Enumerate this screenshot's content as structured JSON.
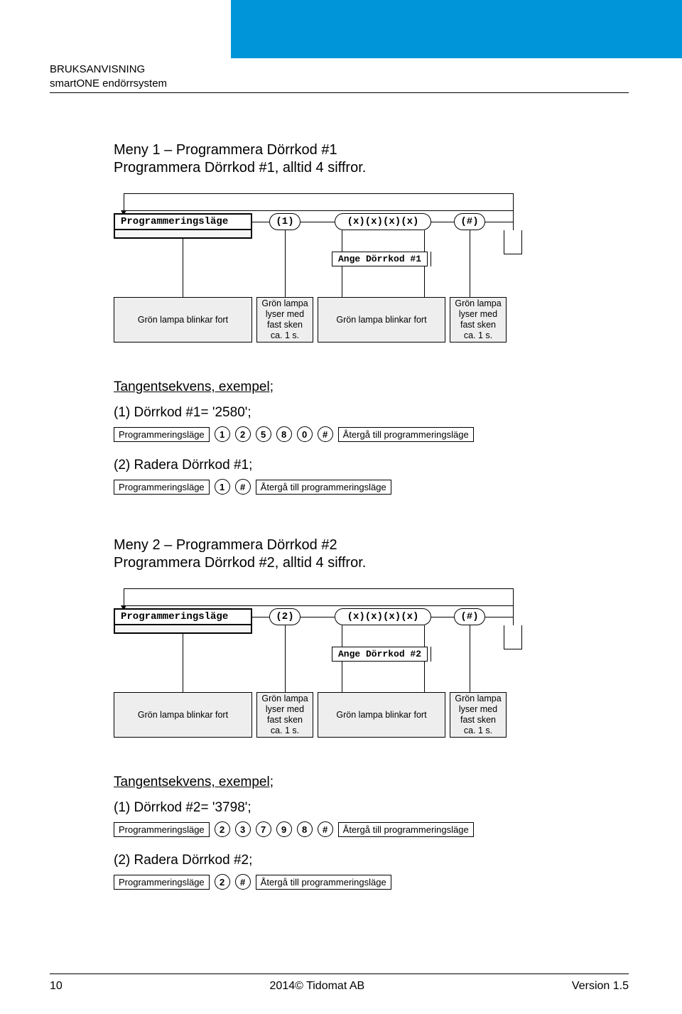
{
  "header": {
    "line1": "BRUKSANVISNING",
    "line2": "smartONE endörrsystem"
  },
  "menu1": {
    "title": "Meny 1 – Programmera Dörrkod #1",
    "subtitle": "Programmera Dörrkod #1, alltid 4 siffror.",
    "flow": {
      "prog": "Programmeringsläge",
      "key1": "(1)",
      "keyx": "(x)(x)(x)(x)",
      "keyh": "(#)",
      "ange": "Ange Dörrkod #1",
      "box1": "Grön lampa blinkar fort",
      "box2": "Grön lampa lyser med fast sken ca. 1 s.",
      "box3": "Grön lampa blinkar fort",
      "box4": "Grön lampa lyser med fast sken ca. 1 s."
    },
    "ex_head": "Tangentsekvens, exempel;",
    "ex1_label": "(1) Dörrkod #1= '2580';",
    "ex1_prog": "Programmeringsläge",
    "ex1_keys": [
      "1",
      "2",
      "5",
      "8",
      "0",
      "#"
    ],
    "ex1_aterga": "Återgå till programmeringsläge",
    "ex2_label": "(2) Radera Dörrkod #1;",
    "ex2_prog": "Programmeringsläge",
    "ex2_keys": [
      "1",
      "#"
    ],
    "ex2_aterga": "Återgå till programmeringsläge"
  },
  "menu2": {
    "title": "Meny 2 – Programmera Dörrkod #2",
    "subtitle": "Programmera Dörrkod #2, alltid 4 siffror.",
    "flow": {
      "prog": "Programmeringsläge",
      "key1": "(2)",
      "keyx": "(x)(x)(x)(x)",
      "keyh": "(#)",
      "ange": "Ange Dörrkod #2",
      "box1": "Grön lampa blinkar fort",
      "box2": "Grön lampa lyser med fast sken ca. 1 s.",
      "box3": "Grön lampa blinkar fort",
      "box4": "Grön lampa lyser med fast sken ca. 1 s."
    },
    "ex_head": "Tangentsekvens, exempel;",
    "ex1_label": "(1) Dörrkod #2= '3798';",
    "ex1_prog": "Programmeringsläge",
    "ex1_keys": [
      "2",
      "3",
      "7",
      "9",
      "8",
      "#"
    ],
    "ex1_aterga": "Återgå till programmeringsläge",
    "ex2_label": "(2) Radera Dörrkod #2;",
    "ex2_prog": "Programmeringsläge",
    "ex2_keys": [
      "2",
      "#"
    ],
    "ex2_aterga": "Återgå till programmeringsläge"
  },
  "footer": {
    "page": "10",
    "center": "2014© Tidomat AB",
    "version": "Version 1.5"
  }
}
